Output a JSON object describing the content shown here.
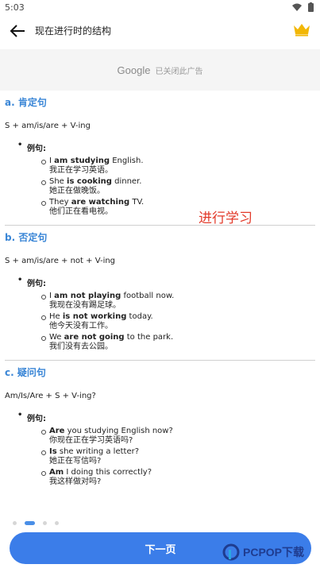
{
  "status_bar": {
    "time": "5:03"
  },
  "app_bar": {
    "title": "现在进行时的结构"
  },
  "ad": {
    "brand": "Google",
    "message": "已关闭此广告"
  },
  "sections": [
    {
      "heading": "a. 肯定句",
      "formula": "S + am/is/are + V-ing",
      "example_label": "例句:",
      "examples": [
        {
          "pre": "I ",
          "bold": "am studying",
          "post": " English.",
          "zh": "我正在学习英语。"
        },
        {
          "pre": "She ",
          "bold": "is cooking",
          "post": " dinner.",
          "zh": "她正在做晚饭。"
        },
        {
          "pre": "They ",
          "bold": "are watching",
          "post": " TV.",
          "zh": "他们正在看电视。"
        }
      ]
    },
    {
      "heading": "b. 否定句",
      "formula": "S + am/is/are + not + V-ing",
      "example_label": "例句:",
      "examples": [
        {
          "pre": "I ",
          "bold": "am not playing",
          "post": " football now.",
          "zh": "我现在没有踢足球。"
        },
        {
          "pre": "He ",
          "bold": "is not working",
          "post": " today.",
          "zh": "他今天没有工作。"
        },
        {
          "pre": "We ",
          "bold": "are not going",
          "post": " to the park.",
          "zh": "我们没有去公园。"
        }
      ]
    },
    {
      "heading": "c. 疑问句",
      "formula": "Am/Is/Are + S + V-ing?",
      "example_label": "例句:",
      "examples": [
        {
          "pre": "",
          "bold": "Are",
          "post": " you studying English now?",
          "bold2": "studying",
          "zh": "你现在正在学习英语吗?"
        },
        {
          "pre": "",
          "bold": "Is",
          "post": " she writing a letter?",
          "zh": "她正在写信吗?"
        },
        {
          "pre": "",
          "bold": "Am",
          "post": " I doing this correctly?",
          "zh": "我这样做对吗?"
        }
      ]
    }
  ],
  "watermark": "进行学习",
  "pager": {
    "count": 4,
    "active_index": 1
  },
  "next_button": {
    "label": "下一页"
  },
  "logo": {
    "text": "PCPOP下载"
  },
  "colors": {
    "accent": "#3b7de9",
    "heading": "#3a86d6",
    "watermark": "#e23a2a",
    "crown": "#f2b705"
  }
}
